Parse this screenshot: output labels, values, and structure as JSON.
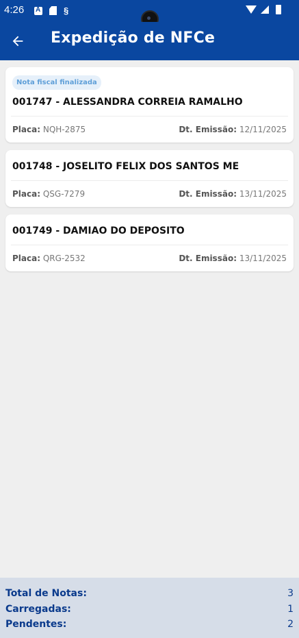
{
  "status_bar": {
    "time": "4:26",
    "left_icons": [
      "accessibility-icon",
      "sd-card-icon",
      "s-icon"
    ],
    "right_icons": [
      "wifi-icon",
      "signal-icon",
      "battery-icon"
    ]
  },
  "app_bar": {
    "title": "Expedição de NFCe",
    "back_icon": "arrow-left-icon",
    "background_color": "#0a47a0"
  },
  "notes": [
    {
      "badge": "Nota fiscal finalizada",
      "title": "001747 - ALESSANDRA CORREIA RAMALHO",
      "placa_label": "Placa:",
      "placa": "NQH-2875",
      "emissao_label": "Dt. Emissão:",
      "emissao": "12/11/2025"
    },
    {
      "badge": "",
      "title": "001748 - JOSELITO FELIX DOS SANTOS ME",
      "placa_label": "Placa:",
      "placa": "QSG-7279",
      "emissao_label": "Dt. Emissão:",
      "emissao": "13/11/2025"
    },
    {
      "badge": "",
      "title": "001749 - DAMIAO DO DEPOSITO",
      "placa_label": "Placa:",
      "placa": "QRG-2532",
      "emissao_label": "Dt. Emissão:",
      "emissao": "13/11/2025"
    }
  ],
  "totals": {
    "total_label": "Total de Notas:",
    "total_value": "3",
    "carregadas_label": "Carregadas:",
    "carregadas_value": "1",
    "pendentes_label": "Pendentes:",
    "pendentes_value": "2",
    "text_color": "#0a3a8c"
  }
}
